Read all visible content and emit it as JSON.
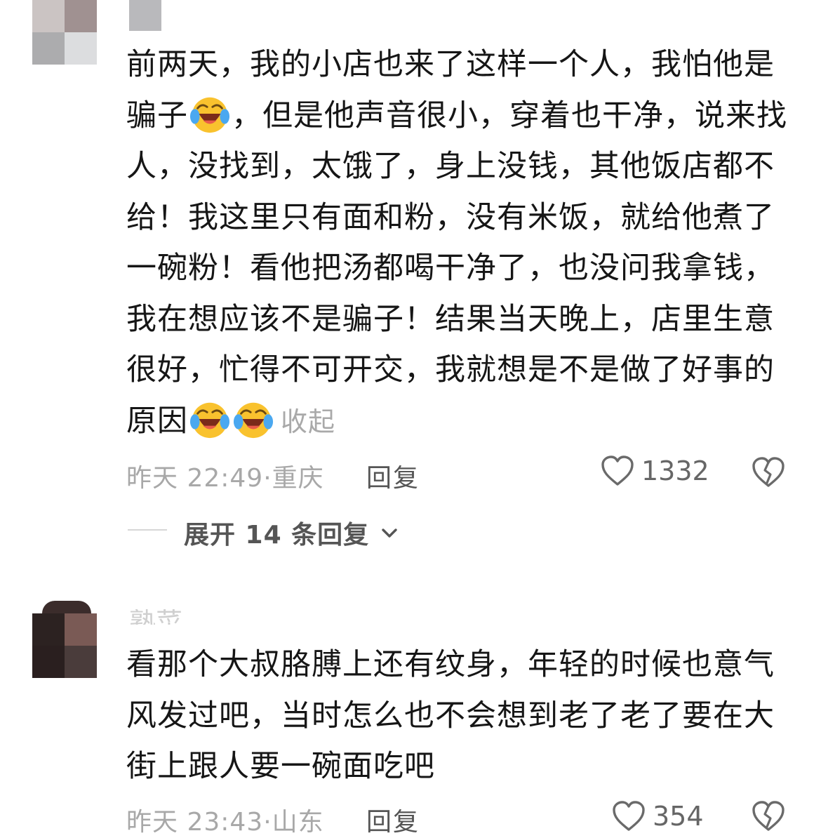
{
  "comments": [
    {
      "text_part1": "前两天，我的小店也来了这样一个人，我怕他是骗子",
      "text_part2": "，但是他声音很小，穿着也干净，说来找人，没找到，太饿了，身上没钱，其他饭店都不给！我这里只有面和粉，没有米饭，就给他煮了一碗粉！看他把汤都喝干净了，也没问我拿钱，我在想应该不是骗子！结果当天晚上，店里生意很好，忙得不可开交，我就想是不是做了好事的原因",
      "collapse_label": "收起",
      "time": "昨天 22:49",
      "separator": "·",
      "location": "重庆",
      "reply_label": "回复",
      "like_count": "1332",
      "expand_label": "展开 14 条回复"
    },
    {
      "username_partial": "熟菜",
      "text": "看那个大叔胳膊上还有纹身，年轻的时候也意气风发过吧，当时怎么也不会想到老了老了要在大街上跟人要一碗面吃吧",
      "time": "昨天 23:43",
      "separator": "·",
      "location": "山东",
      "reply_label": "回复",
      "like_count": "354"
    }
  ],
  "icons": {
    "emoji": "loudly-crying-laughing-emoji",
    "like": "heart-outline-icon",
    "dislike": "broken-heart-icon",
    "expand": "chevron-down-icon"
  },
  "colors": {
    "text": "#161616",
    "meta": "#a8a8a8",
    "reply": "#555555",
    "background": "#ffffff"
  }
}
